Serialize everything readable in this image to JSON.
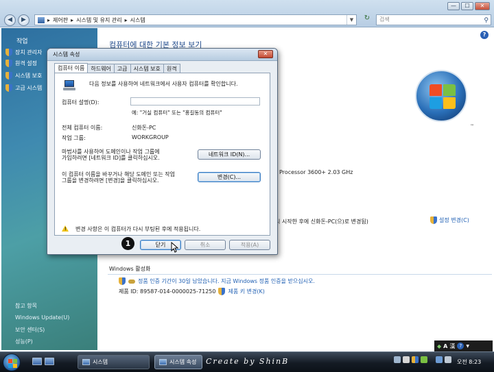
{
  "address_bar": {
    "crumbs": [
      "제어판",
      "시스템 및 유지 관리",
      "시스템"
    ],
    "separator": "▸",
    "search_placeholder": "검색"
  },
  "window_buttons": {
    "minimize": "—",
    "maximize": "☐",
    "close": "✕"
  },
  "nav": {
    "back": "◀",
    "forward": "▶",
    "refresh": "↻"
  },
  "task_pane": {
    "header": "작업",
    "tasks": [
      "장치 관리자",
      "원격 설정",
      "시스템 보호",
      "고급 시스템"
    ],
    "see_also_header": "참고 항목",
    "see_also": [
      "Windows Update(U)",
      "보안 센터(S)",
      "성능(P)"
    ]
  },
  "main": {
    "title": "컴퓨터에 대한 기본 정보 보기",
    "logo_mark": "™",
    "cpu": "Processor 3600+   2.03 GHz",
    "rename_note": "시 시작한 후에 신화돈-PC(으)로 변경됨)",
    "settings_link": "설정 변경(C)",
    "activation_header": "Windows 활성화",
    "activation_message": "정품 인증 기간이 30일 남았습니다. 지금 Windows 정품 인증을 받으십시오.",
    "product_id": "제품 ID: 89587-014-0000025-71250",
    "change_key_link": "제품 키 변경(K)"
  },
  "dialog": {
    "title": "시스템 속성",
    "close_glyph": "✕",
    "tabs": [
      "컴퓨터 이름",
      "하드웨어",
      "고급",
      "시스템 보호",
      "원격"
    ],
    "active_tab": 0,
    "intro": "다음 정보를 사용하여 네트워크에서 사용자 컴퓨터를 확인합니다.",
    "desc_label": "컴퓨터 설명(D):",
    "desc_value": "",
    "desc_example": "예: \"거실 컴퓨터\" 또는 \"홍길동의 컴퓨터\"",
    "full_name_label": "전체 컴퓨터 이름:",
    "full_name_value": "신화돈-PC",
    "workgroup_label": "작업 그룹:",
    "workgroup_value": "WORKGROUP",
    "wizard_text": [
      "마법사를 사용하여 도메인이나 작업 그룹에",
      "가입하려면 [네트워크 ID]를 클릭하십시오."
    ],
    "network_id_button": "네트워크 ID(N)...",
    "change_text": [
      "이 컴퓨터 이름을 바꾸거나 해당 도메인 또는 작업",
      "그룹을 변경하려면 [변경]을 클릭하십시오."
    ],
    "change_button": "변경(C)...",
    "warning": "변경 사항은 이 컴퓨터가 다시 부팅된 후에 적용됩니다.",
    "buttons": {
      "close": "닫기",
      "cancel": "취소",
      "apply": "적용(A)"
    }
  },
  "annotation": {
    "step": "1"
  },
  "langbar": {
    "mode": "A",
    "hanja": "漢",
    "help": "?"
  },
  "taskbar": {
    "items": [
      "시스템",
      "시스템 속성"
    ],
    "watermark": "Create by ShinB",
    "clock": "오전 8:23"
  },
  "colors": {
    "accent": "#1f5fb3",
    "taskbar": "#141b24",
    "pane": "#3f8ab0"
  }
}
